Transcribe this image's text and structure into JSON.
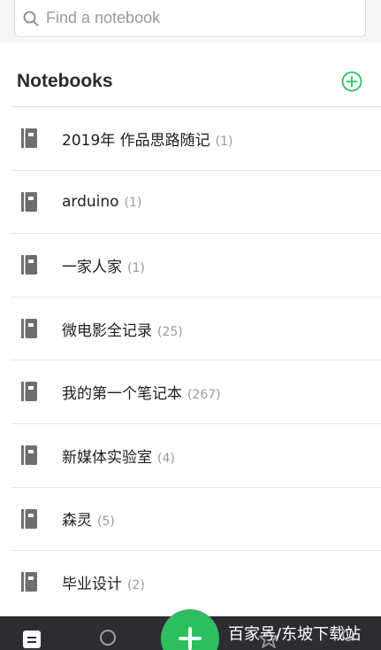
{
  "search": {
    "placeholder": "Find a notebook"
  },
  "header": {
    "title": "Notebooks"
  },
  "notebooks": [
    {
      "name": "2019年 作品思路随记",
      "count": "(1)"
    },
    {
      "name": "arduino",
      "count": "(1)"
    },
    {
      "name": "一家人家",
      "count": "(1)"
    },
    {
      "name": "微电影全记录",
      "count": "(25)"
    },
    {
      "name": "我的第一个笔记本",
      "count": "(267)"
    },
    {
      "name": "新媒体实验室",
      "count": "(4)"
    },
    {
      "name": "森灵",
      "count": "(5)"
    },
    {
      "name": "毕业设计",
      "count": "(2)"
    }
  ],
  "watermark": "百家号/东坡下载站",
  "colors": {
    "accent": "#2dbe60",
    "tabbar": "#2b2d33",
    "icon": "#6e6e6e"
  }
}
